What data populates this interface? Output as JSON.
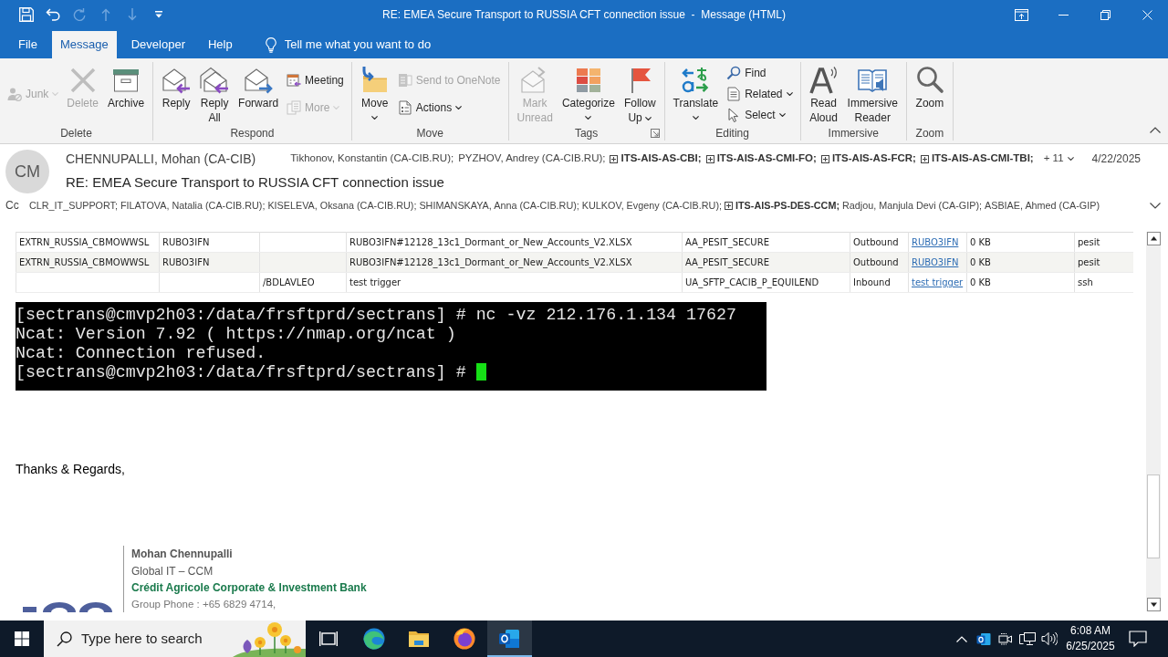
{
  "window": {
    "title": "RE: EMEA Secure Transport to RUSSIA CFT connection issue  -  Message (HTML)"
  },
  "quick_access": [
    {
      "disabled": false
    },
    {
      "disabled": false
    },
    {
      "disabled": true
    },
    {
      "disabled": true
    },
    {
      "disabled": true
    },
    {
      "disabled": false
    }
  ],
  "tabs": [
    {
      "label": "File",
      "selected": false
    },
    {
      "label": "Message",
      "selected": true
    },
    {
      "label": "Developer",
      "selected": false
    },
    {
      "label": "Help",
      "selected": false
    }
  ],
  "tell_me": {
    "label": "Tell me what you want to do"
  },
  "ribbon": {
    "groups": [
      {
        "label": "Delete",
        "items": [
          {
            "kind": "small",
            "label": "Junk",
            "disabled": true,
            "dropdown": true
          },
          {
            "kind": "large",
            "label": "Delete",
            "disabled": true,
            "dropdown": false
          },
          {
            "kind": "large",
            "label": "Archive",
            "disabled": false,
            "dropdown": false
          }
        ]
      },
      {
        "label": "Respond",
        "items": [
          {
            "kind": "large",
            "label": "Reply",
            "disabled": false,
            "dropdown": false
          },
          {
            "kind": "large",
            "label": "Reply All",
            "disabled": false,
            "dropdown": false
          },
          {
            "kind": "large",
            "label": "Forward",
            "disabled": false,
            "dropdown": false
          },
          {
            "kind": "small",
            "label": "Meeting",
            "disabled": false,
            "dropdown": false
          },
          {
            "kind": "small",
            "label": "More",
            "disabled": true,
            "dropdown": true
          }
        ]
      },
      {
        "label": "Move",
        "items": [
          {
            "kind": "large",
            "label": "Move",
            "disabled": false,
            "dropdown": true
          },
          {
            "kind": "small",
            "label": "Send to OneNote",
            "disabled": true,
            "dropdown": false
          },
          {
            "kind": "small",
            "label": "Actions",
            "disabled": false,
            "dropdown": true
          }
        ]
      },
      {
        "label": "Tags",
        "dialog_launcher": true,
        "items": [
          {
            "kind": "large",
            "label": "Mark Unread",
            "disabled": true,
            "dropdown": false
          },
          {
            "kind": "large",
            "label": "Categorize",
            "disabled": false,
            "dropdown": true
          },
          {
            "kind": "large",
            "label": "Follow Up",
            "disabled": false,
            "dropdown": true
          }
        ]
      },
      {
        "label": "Editing",
        "items": [
          {
            "kind": "large",
            "label": "Translate",
            "disabled": false,
            "dropdown": true
          },
          {
            "kind": "small",
            "label": "Find",
            "disabled": false,
            "dropdown": false
          },
          {
            "kind": "small",
            "label": "Related",
            "disabled": false,
            "dropdown": true
          },
          {
            "kind": "small",
            "label": "Select",
            "disabled": false,
            "dropdown": true
          }
        ]
      },
      {
        "label": "Immersive",
        "items": [
          {
            "kind": "large",
            "label": "Read Aloud",
            "disabled": false,
            "dropdown": false
          },
          {
            "kind": "large",
            "label": "Immersive Reader",
            "disabled": false,
            "dropdown": false
          }
        ]
      },
      {
        "label": "Zoom",
        "items": [
          {
            "kind": "large",
            "label": "Zoom",
            "disabled": false,
            "dropdown": false
          }
        ]
      }
    ]
  },
  "message": {
    "avatar": "CM",
    "sender": "CHENNUPALLI, Mohan (CA-CIB)",
    "to": [
      {
        "name": "Tikhonov, Konstantin (CA-CIB.RU);",
        "kind": "person"
      },
      {
        "name": "PYZHOV, Andrey (CA-CIB.RU);",
        "kind": "person"
      },
      {
        "name": "ITS-AIS-AS-CBI;",
        "kind": "group"
      },
      {
        "name": "ITS-AIS-AS-CMI-FO;",
        "kind": "group"
      },
      {
        "name": "ITS-AIS-AS-FCR;",
        "kind": "group"
      },
      {
        "name": "ITS-AIS-AS-CMI-TBI;",
        "kind": "group"
      }
    ],
    "more_recipients": "+ 11",
    "date": "4/22/2025",
    "subject": "RE: EMEA Secure Transport to RUSSIA CFT connection issue",
    "cc_label": "Cc",
    "cc": [
      {
        "name": "CLR_IT_SUPPORT;",
        "kind": "person"
      },
      {
        "name": "FILATOVA, Natalia (CA-CIB.RU);",
        "kind": "person"
      },
      {
        "name": "KISELEVA, Oksana (CA-CIB.RU);",
        "kind": "person"
      },
      {
        "name": "SHIMANSKAYA, Anna (CA-CIB.RU);",
        "kind": "person"
      },
      {
        "name": "KULKOV, Evgeny (CA-CIB.RU);",
        "kind": "person"
      },
      {
        "name": "ITS-AIS-PS-DES-CCM;",
        "kind": "group"
      },
      {
        "name": "Radjou, Manjula Devi (CA-GIP);",
        "kind": "person"
      },
      {
        "name": "ASBIAE, Ahmed (CA-GIP)",
        "kind": "person"
      }
    ]
  },
  "body": {
    "table": {
      "rows": [
        {
          "column_1": "EXTRN_RUSSIA_CBMOWWSL",
          "column_2": "RUBO3IFN",
          "column_4": "RUBO3IFN#12128_13c1_Dormant_or_New_Accounts_V2.XLSX",
          "column_5": "AA_PESIT_SECURE",
          "column_6": "Outbound",
          "column_7": "RUBO3IFN",
          "column_8": "0 KB",
          "column_9": "pesit"
        },
        {
          "column_1": "EXTRN_RUSSIA_CBMOWWSL",
          "column_2": "RUBO3IFN",
          "column_4": "RUBO3IFN#12128_13c1_Dormant_or_New_Accounts_V2.XLSX",
          "column_5": "AA_PESIT_SECURE",
          "column_6": "Outbound",
          "column_7": "RUBO3IFN",
          "column_8": "0 KB",
          "column_9": "pesit"
        },
        {
          "column_3": "/BDLAVLEO",
          "column_4": "test trigger",
          "column_5": "UA_SFTP_CACIB_P_EQUILEND",
          "column_6": "Inbound",
          "column_7": "test trigger",
          "column_8": "0 KB",
          "column_9": "ssh"
        }
      ]
    },
    "terminal": {
      "lines": [
        "[sectrans@cmvp2h03:/data/frsftprd/sectrans] # nc -vz 212.176.1.134 17627",
        "Ncat: Version 7.92 ( https://nmap.org/ncat )",
        "Ncat: Connection refused.",
        "[sectrans@cmvp2h03:/data/frsftprd/sectrans] #"
      ],
      "cursor": true
    },
    "closing": "Thanks & Regards,",
    "signature": {
      "name": "Mohan Chennupalli",
      "title": "Global IT – CCM",
      "company": "Crédit Agricole Corporate & Investment Bank",
      "phone": "Group Phone : +65 6829 4714,"
    }
  },
  "taskbar": {
    "search": {
      "placeholder": "Type here to search"
    },
    "apps": [
      {
        "selected": false
      },
      {
        "selected": false
      },
      {
        "selected": false
      },
      {
        "selected": true
      }
    ],
    "clock": {
      "time": "6:08 AM",
      "date": "6/25/2025"
    }
  }
}
